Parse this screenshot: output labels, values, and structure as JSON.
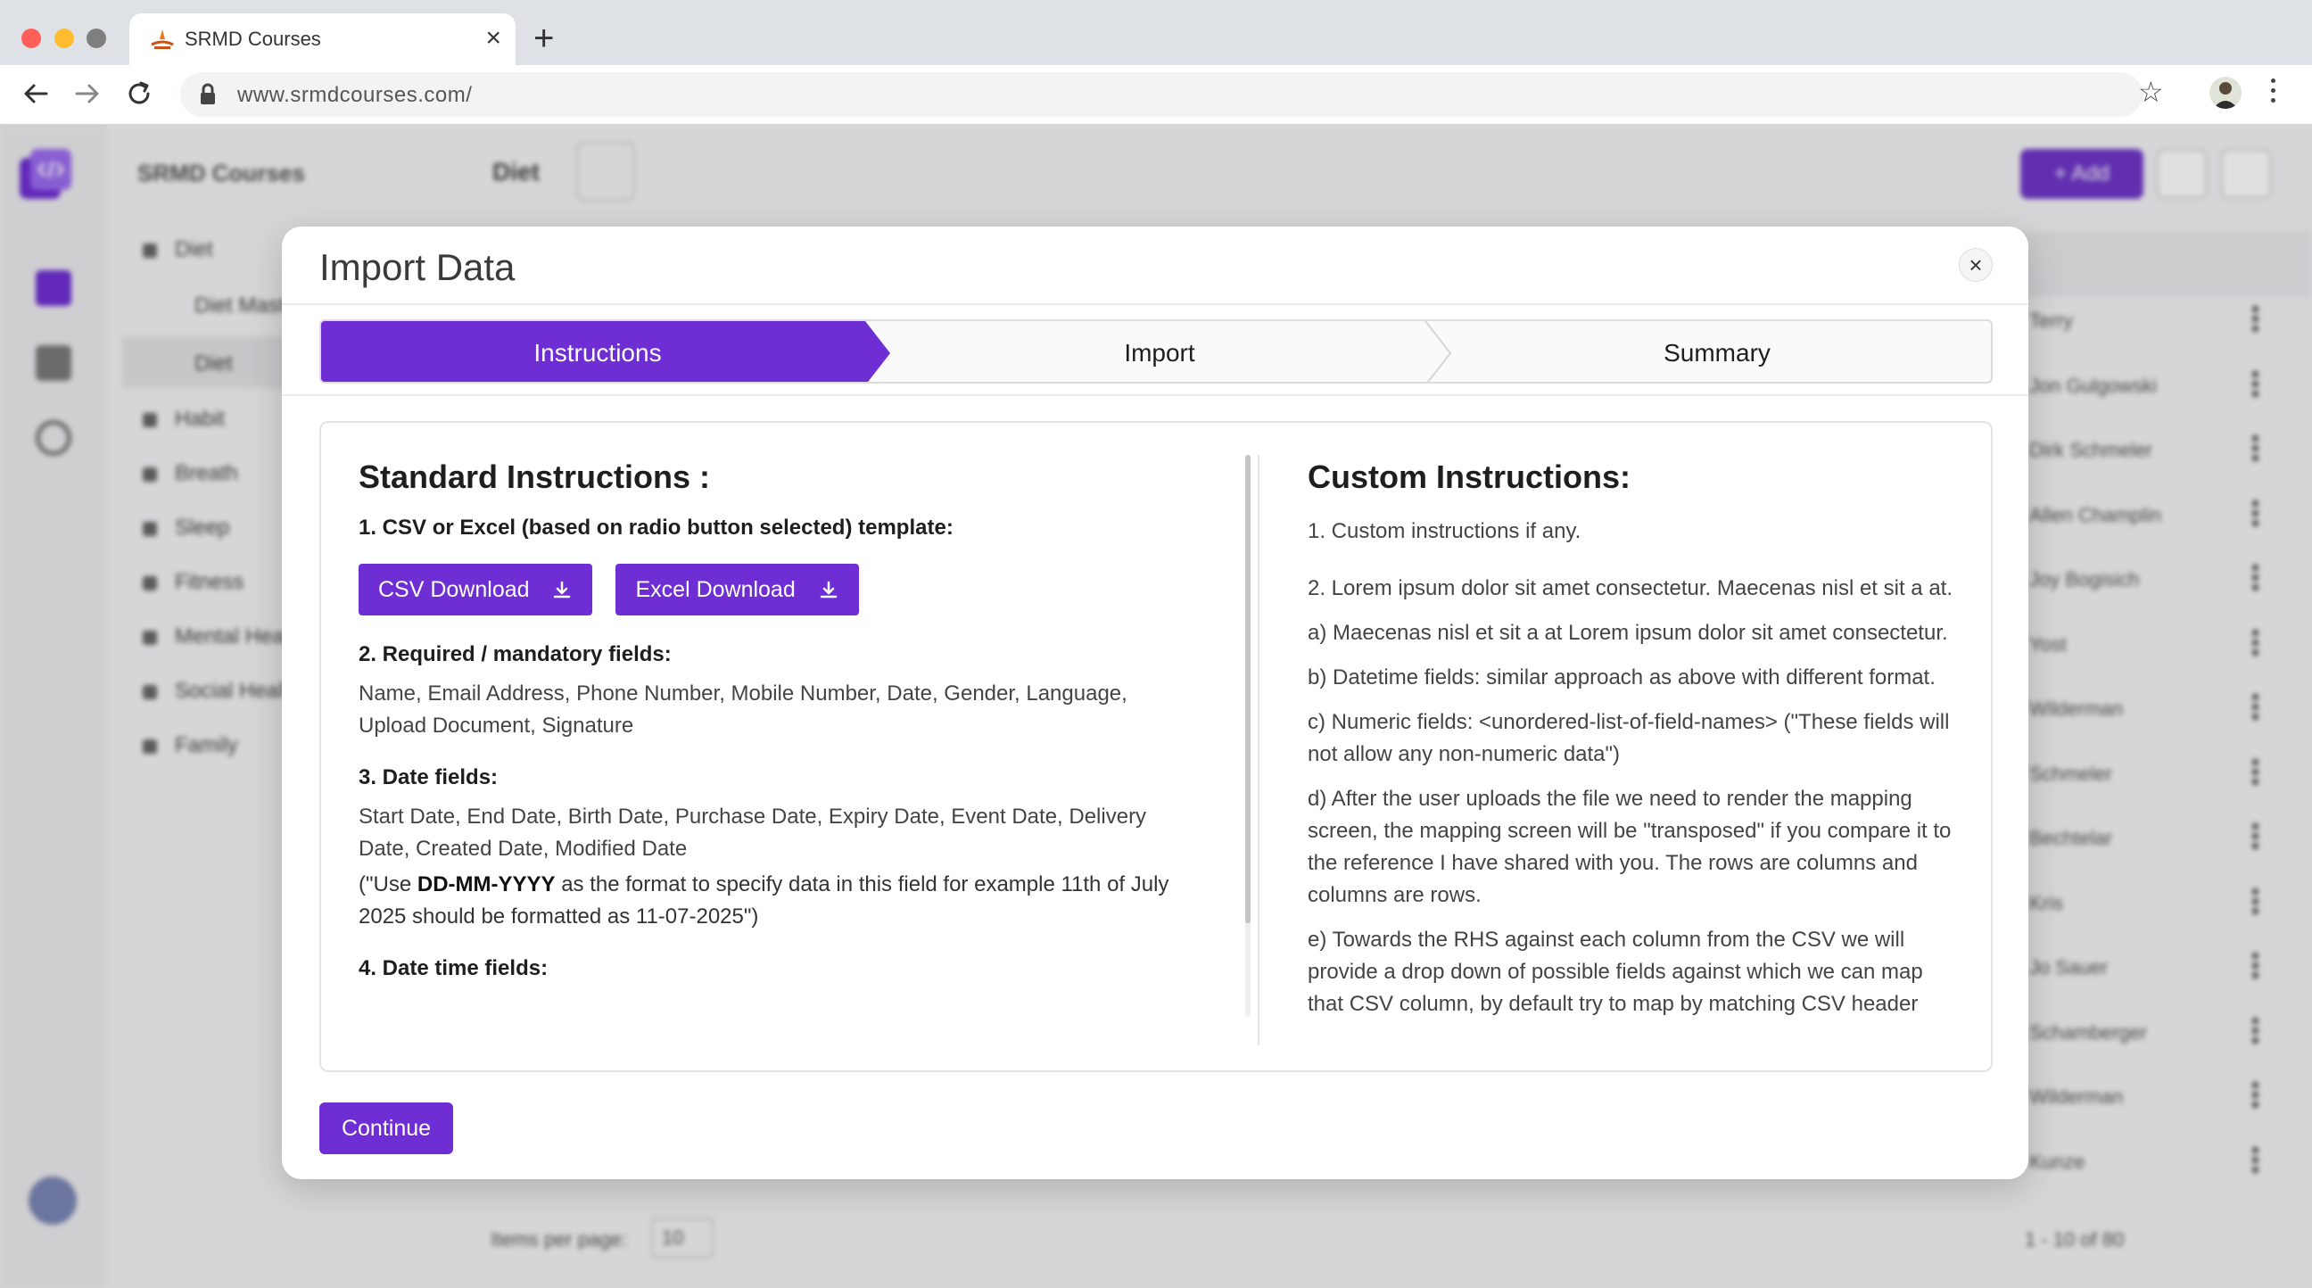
{
  "browser": {
    "tab_title": "SRMD Courses",
    "url": "www.srmdcourses.com/"
  },
  "app": {
    "sidebar_title": "SRMD Courses",
    "sidebar_items": [
      "Diet",
      "Diet Master",
      "Diet",
      "Habit",
      "Breath",
      "Sleep",
      "Fitness",
      "Mental Health",
      "Social Health",
      "Family"
    ],
    "breadcrumb": "Diet",
    "add_label": "+ Add",
    "rows": [
      "Terry",
      "Jon Gulgowski",
      "Dirk Schmeler",
      "Allen Champlin",
      "Joy Bogisich",
      "Yost",
      "Wilderman",
      "Schmeler",
      "Bechtelar",
      "Kris",
      "Jo Sauer",
      "Schamberger",
      "Wilderman",
      "Kunze"
    ],
    "items_per_page_label": "Items per page:",
    "items_per_page_value": "10",
    "range": "1 - 10 of 80"
  },
  "modal": {
    "title": "Import Data",
    "close_glyph": "×",
    "steps": [
      {
        "label": "Instructions",
        "active": true
      },
      {
        "label": "Import",
        "active": false
      },
      {
        "label": "Summary",
        "active": false
      }
    ],
    "standard": {
      "title": "Standard Instructions :",
      "s1_heading": "1. CSV or Excel (based on radio button selected) template:",
      "csv_button": "CSV Download",
      "excel_button": "Excel Download",
      "s2_heading": "2. Required / mandatory fields:",
      "s2_text": "Name, Email Address, Phone Number, Mobile Number, Date, Gender, Language,  Upload Document, Signature",
      "s3_heading": "3. Date fields:",
      "s3_text": "Start Date, End Date, Birth Date, Purchase Date, Expiry Date, Event Date, Delivery Date, Created Date, Modified Date",
      "s3_note_pre": "(\"Use ",
      "s3_note_bold": "DD-MM-YYYY",
      "s3_note_post": " as the format to specify data in this field for example 11th of July 2025 should be formatted as 11-07-2025\")",
      "s4_heading": "4. Date time fields:"
    },
    "custom": {
      "title": "Custom Instructions:",
      "items": [
        "1. Custom instructions if any.",
        "2. Lorem ipsum dolor sit amet consectetur. Maecenas nisl et sit a at.",
        "a) Maecenas nisl et sit a at Lorem ipsum dolor sit amet consectetur.",
        "b) Datetime fields: similar approach as above with different format.",
        "c) Numeric fields: <unordered-list-of-field-names> (\"These fields will not allow any non-numeric data\")",
        "d) After the user uploads the file we need to render the mapping screen, the mapping screen will be \"transposed\" if you compare it to the reference I have shared with you. The rows are columns and columns are rows.",
        "e) Towards the RHS against each column from the CSV we will provide a drop down of possible fields against which we can map that CSV column, by default try to map by matching CSV header with the"
      ]
    },
    "continue_label": "Continue"
  },
  "colors": {
    "accent": "#6f2ed3",
    "tabbar": "#dee1e6"
  }
}
